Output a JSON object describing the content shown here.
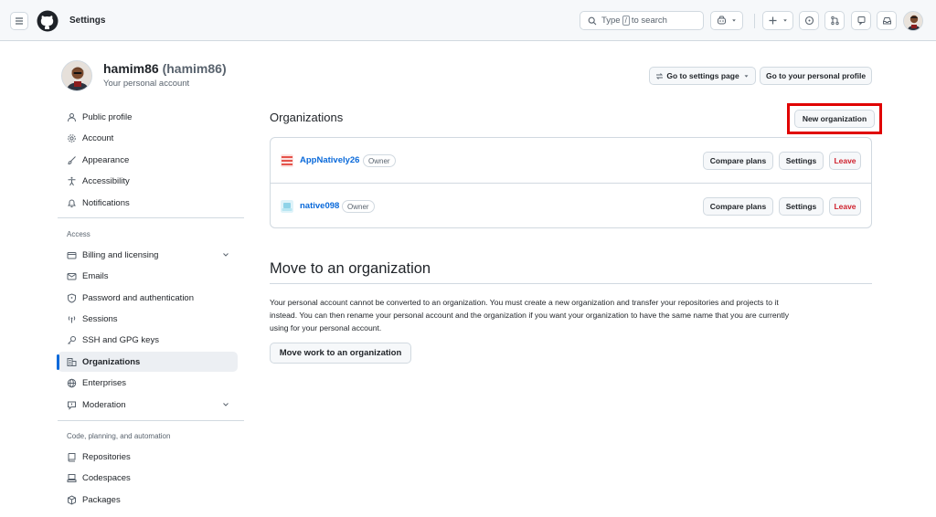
{
  "header": {
    "title": "Settings",
    "search": {
      "prefix": "Type",
      "key": "/",
      "suffix": "to search"
    }
  },
  "profile": {
    "name": "hamim86",
    "login": "(hamim86)",
    "subtitle": "Your personal account",
    "go_settings_label": "Go to settings page",
    "go_profile_label": "Go to your personal profile"
  },
  "sidebar": {
    "items_top": [
      {
        "label": "Public profile",
        "icon": "person-icon"
      },
      {
        "label": "Account",
        "icon": "gear-icon"
      },
      {
        "label": "Appearance",
        "icon": "paintbrush-icon"
      },
      {
        "label": "Accessibility",
        "icon": "accessibility-icon"
      },
      {
        "label": "Notifications",
        "icon": "bell-icon"
      }
    ],
    "access_heading": "Access",
    "items_access": [
      {
        "label": "Billing and licensing",
        "icon": "credit-card-icon"
      },
      {
        "label": "Emails",
        "icon": "mail-icon"
      },
      {
        "label": "Password and authentication",
        "icon": "shield-lock-icon"
      },
      {
        "label": "Sessions",
        "icon": "broadcast-icon"
      },
      {
        "label": "SSH and GPG keys",
        "icon": "key-icon"
      },
      {
        "label": "Organizations",
        "icon": "organization-icon"
      },
      {
        "label": "Enterprises",
        "icon": "globe-icon"
      },
      {
        "label": "Moderation",
        "icon": "report-icon"
      }
    ],
    "code_heading": "Code, planning, and automation",
    "items_code": [
      {
        "label": "Repositories",
        "icon": "repo-icon"
      },
      {
        "label": "Codespaces",
        "icon": "codespaces-icon"
      },
      {
        "label": "Packages",
        "icon": "package-icon"
      }
    ]
  },
  "organizations": {
    "title": "Organizations",
    "new_button": "New organization",
    "list": [
      {
        "name": "AppNatively26",
        "role": "Owner",
        "compare": "Compare plans",
        "settings": "Settings",
        "leave": "Leave",
        "icon_color": "#e5534b"
      },
      {
        "name": "native098",
        "role": "Owner",
        "compare": "Compare plans",
        "settings": "Settings",
        "leave": "Leave",
        "icon_color": "#8fd3e8"
      }
    ]
  },
  "move": {
    "title": "Move to an organization",
    "line1": "Your personal account cannot be converted to an organization. You must create a new organization and transfer your repositories and projects to it",
    "line2": "instead. You can then rename your personal account and the organization if you want your organization to have the same name that you are currently",
    "line3": "using for your personal account.",
    "button": "Move work to an organization"
  },
  "colors": {
    "accent": "#0969da",
    "danger": "#cf222e",
    "highlight": "#e00000"
  }
}
